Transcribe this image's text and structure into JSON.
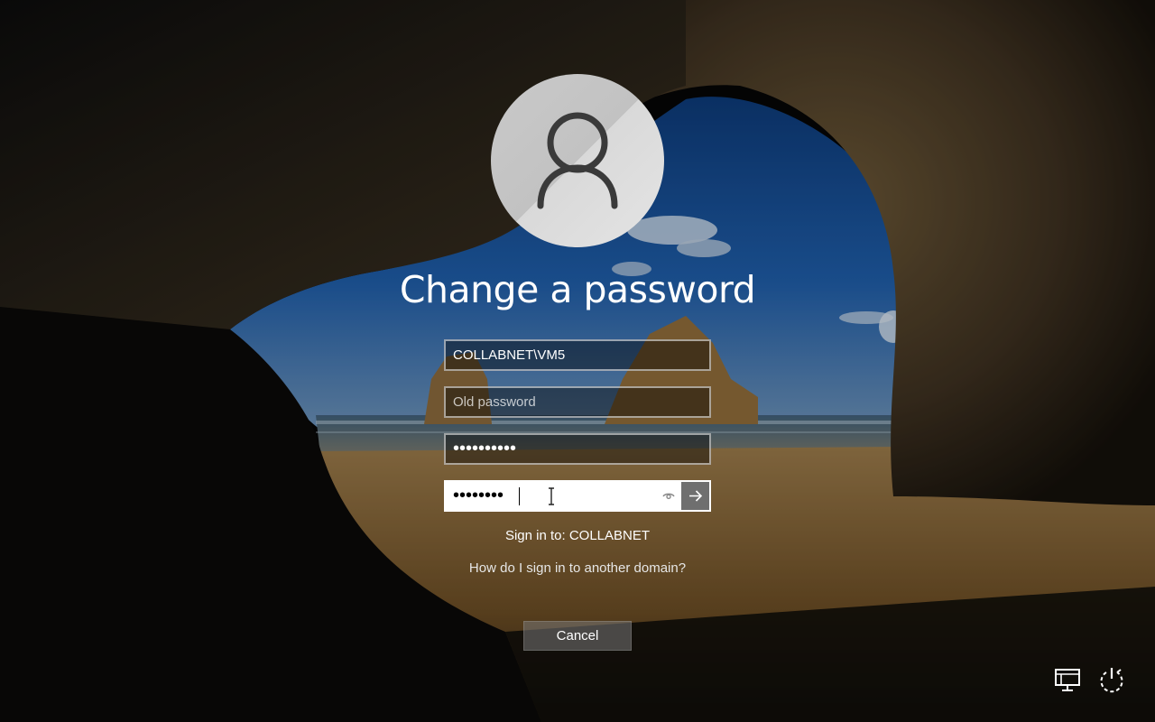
{
  "page": {
    "title": "Change a password"
  },
  "form": {
    "username_value": "COLLABNET\\VM5",
    "old_password_placeholder": "Old password",
    "old_password_value": "",
    "new_password_value": "••••••••••",
    "confirm_password_value": "••••••••"
  },
  "sign_in_to": "Sign in to: COLLABNET",
  "other_domain_link": "How do I sign in to another domain?",
  "cancel_label": "Cancel",
  "icons": {
    "avatar": "user-silhouette-icon",
    "reveal": "eye-icon",
    "submit": "arrow-right-icon",
    "network": "network-icon",
    "power": "power-icon"
  },
  "colors": {
    "submit_button": "#6f6f6f",
    "avatar_bg": "#c9c9c9"
  }
}
